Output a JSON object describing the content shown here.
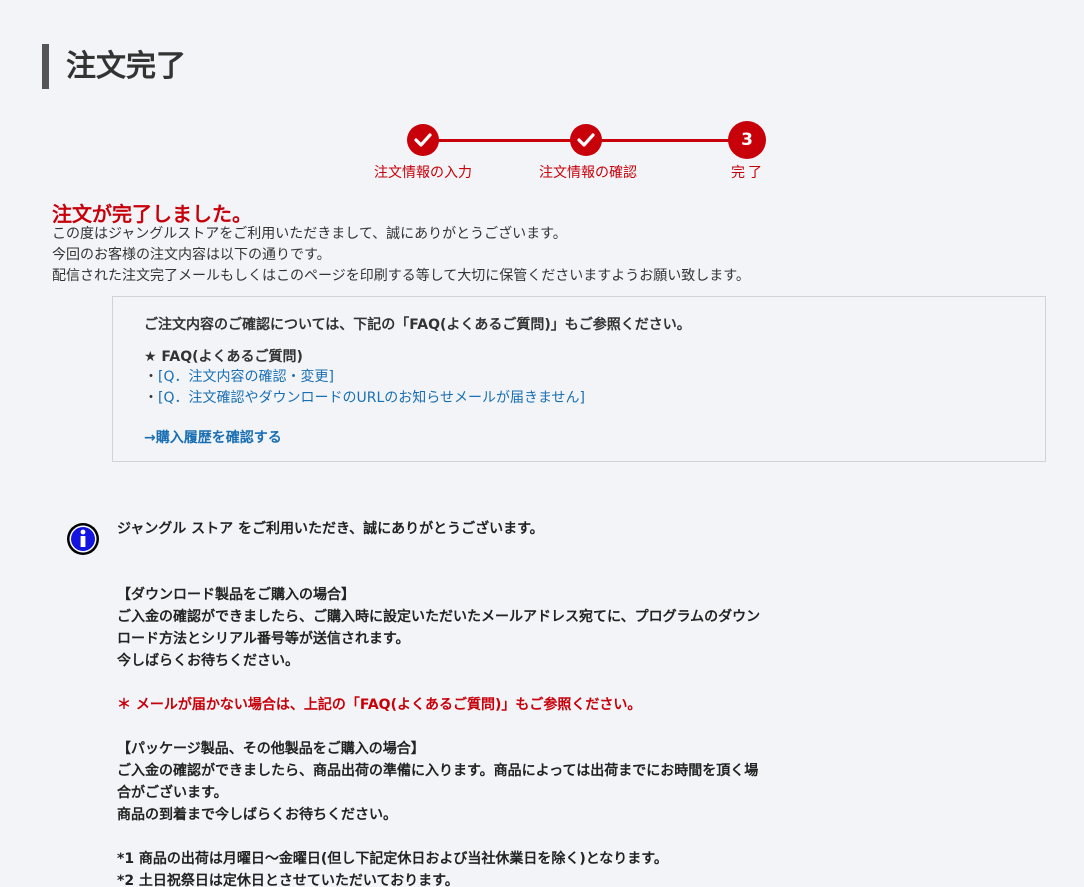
{
  "page": {
    "title": "注文完了"
  },
  "stepper": {
    "steps": [
      {
        "label": "注文情報の入力",
        "state": "done"
      },
      {
        "label": "注文情報の確認",
        "state": "done"
      },
      {
        "label": "完了",
        "number": "3",
        "state": "current"
      }
    ],
    "color": "#c8000a"
  },
  "complete": {
    "heading": "注文が完了しました。",
    "lines": [
      "この度はジャングルストアをご利用いただきまして、誠にありがとうございます。",
      "今回のお客様の注文内容は以下の通りです。",
      "配信された注文完了メールもしくはこのページを印刷する等して大切に保管くださいますようお願い致します。"
    ]
  },
  "faq_box": {
    "note": "ご注文内容のご確認については、下記の「FAQ(よくあるご質問)」もご参照ください。",
    "faq_title": "★ FAQ(よくあるご質問)",
    "bullet": "・",
    "links": [
      "[Q．注文内容の確認・変更]",
      "[Q．注文確認やダウンロードのURLのお知らせメールが届きません]"
    ],
    "history_link": "→購入履歴を確認する"
  },
  "info": {
    "icon": "info-icon",
    "thanks": "ジャングル ストア をご利用いただき、誠にありがとうございます。",
    "download_heading": "【ダウンロード製品をご購入の場合】",
    "download_line1": "ご入金の確認ができましたら、ご購入時に設定いただいたメールアドレス宛てに、プログラムのダウン",
    "download_line2": "ロード方法とシリアル番号等が送信されます。",
    "download_line3": "今しばらくお待ちください。",
    "mail_note": "＊ メールが届かない場合は、上記の「FAQ(よくあるご質問)」もご参照ください。",
    "package_heading": "【パッケージ製品、その他製品をご購入の場合】",
    "package_line1": "ご入金の確認ができましたら、商品出荷の準備に入ります。商品によっては出荷までにお時間を頂く場",
    "package_line2": "合がございます。",
    "package_line3": "商品の到着まで今しばらくお待ちください。",
    "note1": "*1 商品の出荷は月曜日～金曜日(但し下記定休日および当社休業日を除く)となります。",
    "note2": "*2 土日祝祭日は定休日とさせていただいております。"
  }
}
